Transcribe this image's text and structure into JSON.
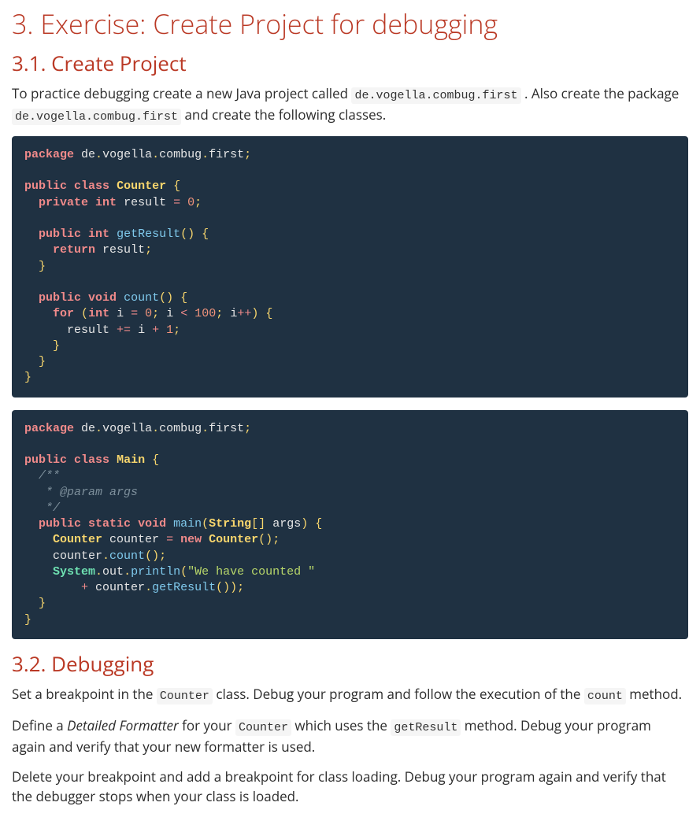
{
  "section": {
    "title": "3. Exercise: Create Project for debugging",
    "sub1": {
      "title": "3.1. Create Project",
      "para1_a": "To practice debugging create a new Java project called ",
      "para1_code1": "de.vogella.combug.first",
      "para1_b": ". Also create the package ",
      "para1_code2": "de.vogella.combug.first",
      "para1_c": " and create the following classes."
    },
    "sub2": {
      "title": "3.2. Debugging",
      "para1_a": "Set a breakpoint in the ",
      "para1_code1": "Counter",
      "para1_b": " class. Debug your program and follow the execution of the ",
      "para1_code2": "count",
      "para1_c": " method.",
      "para2_a": "Define a ",
      "para2_em": "Detailed Formatter",
      "para2_b": " for your ",
      "para2_code1": "Counter",
      "para2_c": " which uses the ",
      "para2_code2": "getResult",
      "para2_d": " method. Debug your program again and verify that your new formatter is used.",
      "para3": "Delete your breakpoint and add a breakpoint for class loading. Debug your program again and verify that the debugger stops when your class is loaded."
    }
  },
  "code1": {
    "t": {
      "package": "package",
      "de": "de",
      "vogella": "vogella",
      "combug": "combug",
      "first": "first",
      "public": "public",
      "class": "class",
      "Counter": "Counter",
      "private": "private",
      "int": "int",
      "result": "result",
      "zero": "0",
      "getResult": "getResult",
      "return": "return",
      "void": "void",
      "count": "count",
      "for": "for",
      "i": "i",
      "hundred": "100",
      "one": "1",
      "dot": ".",
      "semi": ";",
      "lb": "{",
      "rb": "}",
      "lp": "(",
      "rp": ")",
      "eq": "=",
      "lt": "<",
      "pp": "++",
      "peq": "+=",
      "plus": "+"
    }
  },
  "code2": {
    "t": {
      "package": "package",
      "de": "de",
      "vogella": "vogella",
      "combug": "combug",
      "first": "first",
      "public": "public",
      "class": "class",
      "Main": "Main",
      "comment1": "/**",
      "comment2": "   * @param args",
      "comment3": "   */",
      "static": "static",
      "void": "void",
      "main": "main",
      "String": "String",
      "lbracket": "[",
      "rbracket": "]",
      "args": "args",
      "Counter": "Counter",
      "counter": "counter",
      "new": "new",
      "count": "count",
      "System": "System",
      "out": "out",
      "println": "println",
      "str": "\"We have counted \"",
      "getResult": "getResult",
      "dot": ".",
      "semi": ";",
      "lb": "{",
      "rb": "}",
      "lp": "(",
      "rp": ")",
      "eq": "=",
      "plus": "+"
    }
  }
}
